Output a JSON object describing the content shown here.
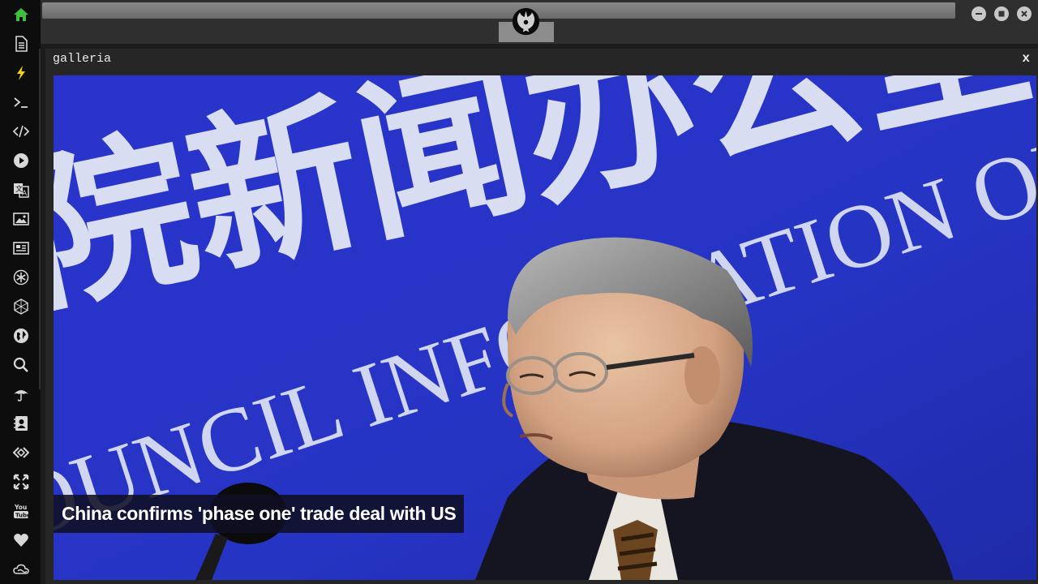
{
  "sidebar": {
    "items": [
      {
        "icon": "home-icon",
        "color": "#3fbf3f"
      },
      {
        "icon": "document-icon",
        "color": "#d8d8d8"
      },
      {
        "icon": "lightning-icon",
        "color": "#f2d21b"
      },
      {
        "icon": "terminal-icon",
        "color": "#d8d8d8"
      },
      {
        "icon": "code-icon",
        "color": "#d8d8d8"
      },
      {
        "icon": "play-circle-icon",
        "color": "#d8d8d8"
      },
      {
        "icon": "translate-icon",
        "color": "#d8d8d8"
      },
      {
        "icon": "image-icon",
        "color": "#d8d8d8"
      },
      {
        "icon": "newspaper-icon",
        "color": "#d8d8d8"
      },
      {
        "icon": "asterisk-circle-icon",
        "color": "#d8d8d8"
      },
      {
        "icon": "hexagon-network-icon",
        "color": "#d8d8d8"
      },
      {
        "icon": "globe-icon",
        "color": "#d8d8d8"
      },
      {
        "icon": "search-icon",
        "color": "#d8d8d8"
      },
      {
        "icon": "umbrella-icon",
        "color": "#d8d8d8"
      },
      {
        "icon": "contacts-icon",
        "color": "#d8d8d8"
      },
      {
        "icon": "diamond-arrows-icon",
        "color": "#d8d8d8"
      },
      {
        "icon": "expand-icon",
        "color": "#d8d8d8"
      },
      {
        "icon": "youtube-icon",
        "color": "#d8d8d8"
      },
      {
        "icon": "heart-icon",
        "color": "#d8d8d8"
      },
      {
        "icon": "cloud-icon",
        "color": "#d8d8d8"
      }
    ]
  },
  "topbar": {
    "logo_icon": "rebel-alliance-logo-icon",
    "window_controls": [
      "minimize-icon",
      "maximize-icon",
      "close-icon"
    ]
  },
  "window": {
    "title": "galleria",
    "close_label": "x"
  },
  "gallery": {
    "backdrop_line1": "院新闻办公室",
    "backdrop_line2": "OUNCIL INFORMATION OFFICE, P.R",
    "caption": "China confirms 'phase one' trade deal with US"
  },
  "colors": {
    "accent_green": "#3fbf3f",
    "accent_yellow": "#f2d21b",
    "backdrop_blue": "#2431c8"
  }
}
